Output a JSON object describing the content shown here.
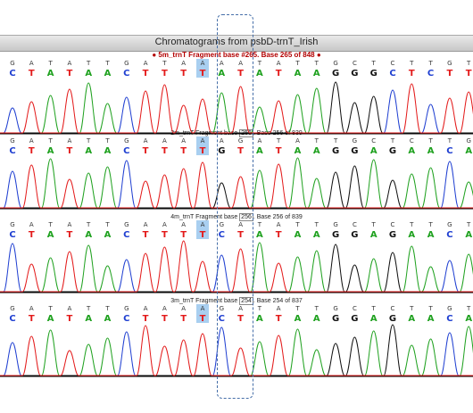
{
  "window": {
    "title": "Chromatograms from psbD-trnT_Irish"
  },
  "tracks": [
    {
      "header": "5m_trnT Fragment base #265. Base 265 of 848",
      "header_prefix": "5m_trnT Fragment base",
      "base_num": "#265",
      "header_suffix": ". Base 265 of 848",
      "top_calls": "GATATTGATAAAATATTGCTCTTGT",
      "bottom_calls": "CTATAACTTTTATATAAGGGCTCTTG",
      "highlight_top_index": 10,
      "highlight_bottom_index": 10
    },
    {
      "header": "2m_trnT Fragment base 256. Base 256 of 839",
      "header_prefix": "2m_trnT Fragment base",
      "base_num": "256",
      "header_suffix": ". Base 256 of 839",
      "top_calls": "GATATTGAAAAAGATATTGCTCTTGT",
      "bottom_calls": "CTATAACTTTTGTATAAGGAGAACA",
      "highlight_top_index": 10,
      "highlight_bottom_index": 10
    },
    {
      "header": "4m_trnT Fragment base 256. Base 256 of 839",
      "header_prefix": "4m_trnT Fragment base",
      "base_num": "256",
      "header_suffix": ". Base 256 of 839",
      "top_calls": "GATATTGAAAAGATATTGCTCTTGT",
      "bottom_calls": "CTATAACTTTTCTATAAGGAGAACA",
      "highlight_top_index": 10,
      "highlight_bottom_index": 10
    },
    {
      "header": "3m_trnT Fragment base 254. Base 254 of 837",
      "header_prefix": "3m_trnT Fragment base",
      "base_num": "254",
      "header_suffix": ". Base 254 of 837",
      "top_calls": "GATATTGAAAAGATATTGCTCTTGT",
      "bottom_calls": "CTATAACTTTTCTATAAGGAGAACA",
      "highlight_top_index": 10,
      "highlight_bottom_index": 10
    }
  ],
  "colors": {
    "A": "#1fa11f",
    "C": "#1f3fd1",
    "G": "#111111",
    "T": "#e31a1a",
    "highlight": "#a9cff0"
  }
}
